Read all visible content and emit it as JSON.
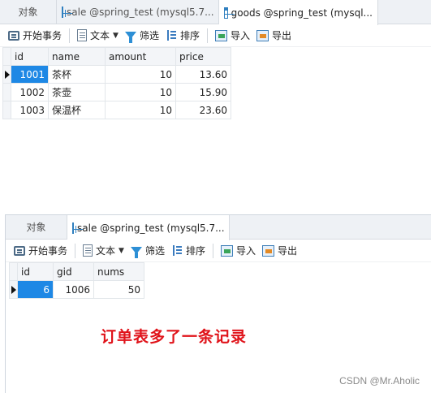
{
  "panel1": {
    "tabs": [
      {
        "label": "对象",
        "icon": null
      },
      {
        "label": "sale @spring_test (mysql5.7...",
        "icon": "table-icon"
      },
      {
        "label": "goods @spring_test (mysql...",
        "icon": "table-icon"
      }
    ],
    "toolbar": {
      "begin_tx": "开始事务",
      "text": "文本",
      "filter": "筛选",
      "sort": "排序",
      "import": "导入",
      "export": "导出"
    },
    "table": {
      "columns": [
        "id",
        "name",
        "amount",
        "price"
      ],
      "rows": [
        {
          "id": "1001",
          "name": "茶杯",
          "amount": "10",
          "price": "13.60"
        },
        {
          "id": "1002",
          "name": "茶壶",
          "amount": "10",
          "price": "15.90"
        },
        {
          "id": "1003",
          "name": "保温杯",
          "amount": "10",
          "price": "23.60"
        }
      ]
    }
  },
  "panel2": {
    "tabs": [
      {
        "label": "对象",
        "icon": null
      },
      {
        "label": "sale @spring_test (mysql5.7...",
        "icon": "table-icon"
      }
    ],
    "toolbar": {
      "begin_tx": "开始事务",
      "text": "文本",
      "filter": "筛选",
      "sort": "排序",
      "import": "导入",
      "export": "导出"
    },
    "table": {
      "columns": [
        "id",
        "gid",
        "nums"
      ],
      "rows": [
        {
          "id": "6",
          "gid": "1006",
          "nums": "50"
        }
      ]
    }
  },
  "annotation": "订单表多了一条记录",
  "watermark": "CSDN @Mr.Aholic",
  "colors": {
    "selection": "#1e88e5",
    "annotation": "#e0131a"
  }
}
